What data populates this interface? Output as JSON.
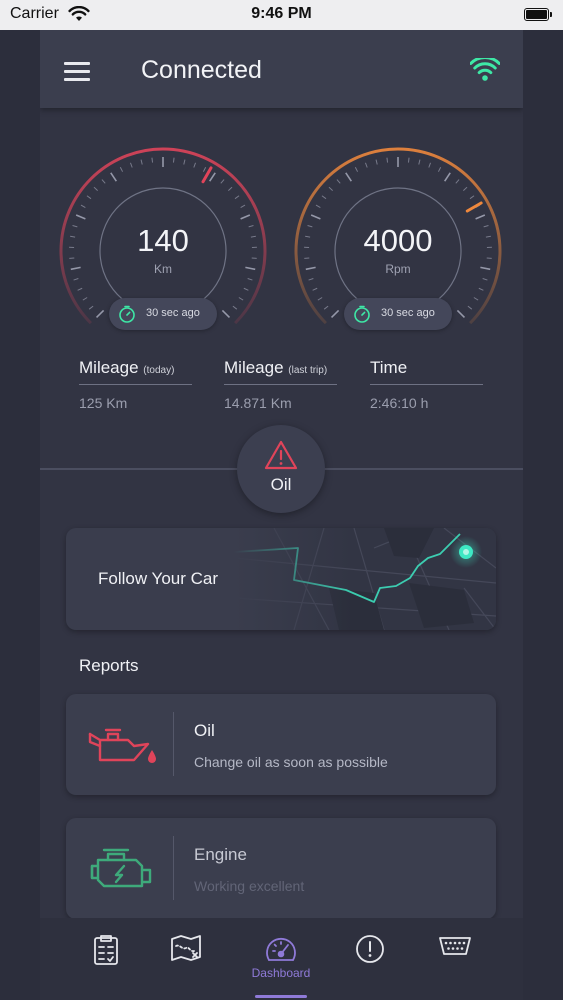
{
  "status_bar": {
    "carrier": "Carrier",
    "time": "9:46 PM",
    "icons": [
      "wifi-icon",
      "battery-icon"
    ]
  },
  "header": {
    "title": "Connected",
    "menu_icon": "hamburger-icon",
    "connection_icon": "wifi-icon",
    "connection_color": "#3ee8a6"
  },
  "gauges": [
    {
      "value": "140",
      "unit": "Km",
      "updated": "30 sec ago",
      "accent": "#e0445a",
      "icon": "timer-icon"
    },
    {
      "value": "4000",
      "unit": "Rpm",
      "updated": "30 sec ago",
      "accent": "#f0883c",
      "icon": "timer-icon"
    }
  ],
  "stats": [
    {
      "title": "Mileage",
      "qualifier": "(today)",
      "value": "125 Km"
    },
    {
      "title": "Mileage",
      "qualifier": "(last trip)",
      "value": "14.871 Km"
    },
    {
      "title": "Time",
      "qualifier": "",
      "value": "2:46:10 h"
    }
  ],
  "alert": {
    "label": "Oil",
    "icon": "warning-icon",
    "color": "#e0445a"
  },
  "map_card": {
    "title": "Follow Your Car",
    "icon": "map-preview",
    "route_color": "#3ee8c4"
  },
  "reports": {
    "title": "Reports",
    "items": [
      {
        "title": "Oil",
        "description": "Change oil as soon as possible",
        "icon": "oil-can-icon",
        "color": "#e0445a"
      },
      {
        "title": "Engine",
        "description": "Working excellent",
        "icon": "engine-icon",
        "color": "#3fcf8a"
      }
    ]
  },
  "bottom_nav": {
    "active_color": "#8f7ad8",
    "items": [
      {
        "icon": "clipboard-icon",
        "label": ""
      },
      {
        "icon": "map-icon",
        "label": ""
      },
      {
        "icon": "speedometer-icon",
        "label": "Dashboard",
        "active": true
      },
      {
        "icon": "alert-circle-icon",
        "label": ""
      },
      {
        "icon": "obd-port-icon",
        "label": ""
      }
    ]
  }
}
